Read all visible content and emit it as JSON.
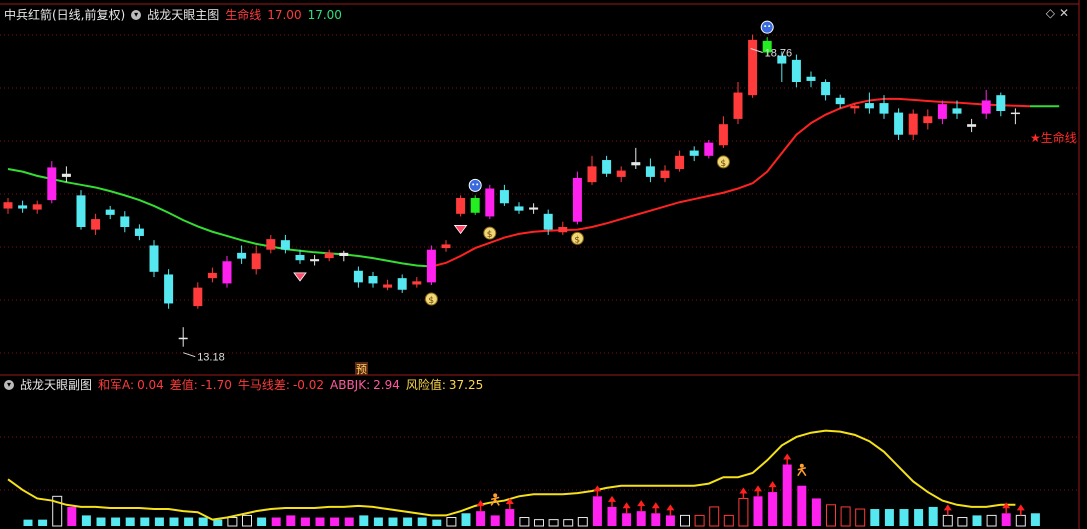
{
  "main_header": {
    "stock": "中兵红箭(日线,前复权)",
    "indicator": "战龙天眼主图",
    "life_line_label": "生命线",
    "life_line_val1": "17.00",
    "life_line_val2": "17.00"
  },
  "sub_header": {
    "indicator": "战龙天眼副图",
    "hejun_label": "和军A:",
    "hejun_val": "0.04",
    "chazhi_label": "差值:",
    "chazhi_val": "-1.70",
    "niuma_label": "牛马线差:",
    "niuma_val": "-0.02",
    "abbjk_label": "ABBJK:",
    "abbjk_val": "2.94",
    "risk_label": "风险值:",
    "risk_val": "37.25"
  },
  "annotations": {
    "high_label": "18.76",
    "low_label": "13.18",
    "life_line_tag": "★生命线",
    "pre_mark": "预"
  },
  "colors": {
    "up": "#ff3b3b",
    "down": "#55e8f0",
    "magenta": "#ff22ee",
    "green_line": "#33dd33",
    "red_line": "#ff2222",
    "yellow_line": "#f5e11a",
    "grid": "#7a1010"
  },
  "chart_data": [
    {
      "type": "candlestick",
      "title": "战龙天眼主图",
      "ylim": [
        12.7,
        19.3
      ],
      "candles": [
        {
          "o": 15.8,
          "c": 15.92,
          "h": 16.0,
          "l": 15.7,
          "style": "up"
        },
        {
          "o": 15.86,
          "c": 15.8,
          "h": 15.95,
          "l": 15.72,
          "style": "down"
        },
        {
          "o": 15.78,
          "c": 15.88,
          "h": 15.95,
          "l": 15.7,
          "style": "up"
        },
        {
          "o": 15.96,
          "c": 16.58,
          "h": 16.7,
          "l": 15.9,
          "style": "magenta"
        },
        {
          "o": 16.4,
          "c": 16.46,
          "h": 16.6,
          "l": 16.3,
          "style": "doji"
        },
        {
          "o": 16.05,
          "c": 15.45,
          "h": 16.15,
          "l": 15.4,
          "style": "down"
        },
        {
          "o": 15.4,
          "c": 15.6,
          "h": 15.7,
          "l": 15.3,
          "style": "up"
        },
        {
          "o": 15.78,
          "c": 15.68,
          "h": 15.85,
          "l": 15.6,
          "style": "down"
        },
        {
          "o": 15.65,
          "c": 15.45,
          "h": 15.75,
          "l": 15.35,
          "style": "down"
        },
        {
          "o": 15.42,
          "c": 15.28,
          "h": 15.5,
          "l": 15.2,
          "style": "down"
        },
        {
          "o": 15.1,
          "c": 14.6,
          "h": 15.2,
          "l": 14.5,
          "style": "down"
        },
        {
          "o": 14.55,
          "c": 14.0,
          "h": 14.65,
          "l": 13.9,
          "style": "down"
        },
        {
          "o": 13.35,
          "c": 13.35,
          "h": 13.55,
          "l": 13.18,
          "style": "doji"
        },
        {
          "o": 13.95,
          "c": 14.3,
          "h": 14.4,
          "l": 13.9,
          "style": "up"
        },
        {
          "o": 14.48,
          "c": 14.58,
          "h": 14.68,
          "l": 14.4,
          "style": "up"
        },
        {
          "o": 14.38,
          "c": 14.8,
          "h": 14.9,
          "l": 14.3,
          "style": "magenta"
        },
        {
          "o": 14.85,
          "c": 14.96,
          "h": 15.1,
          "l": 14.75,
          "style": "down"
        },
        {
          "o": 14.65,
          "c": 14.95,
          "h": 15.1,
          "l": 14.55,
          "style": "up"
        },
        {
          "o": 15.02,
          "c": 15.22,
          "h": 15.3,
          "l": 14.95,
          "style": "up"
        },
        {
          "o": 15.2,
          "c": 15.02,
          "h": 15.3,
          "l": 14.95,
          "style": "down"
        },
        {
          "o": 14.92,
          "c": 14.82,
          "h": 15.02,
          "l": 14.75,
          "style": "down"
        },
        {
          "o": 14.8,
          "c": 14.84,
          "h": 14.92,
          "l": 14.72,
          "style": "doji"
        },
        {
          "o": 14.86,
          "c": 14.96,
          "h": 15.02,
          "l": 14.8,
          "style": "up"
        },
        {
          "o": 14.96,
          "c": 14.9,
          "h": 15.0,
          "l": 14.8,
          "style": "doji"
        },
        {
          "o": 14.62,
          "c": 14.4,
          "h": 14.7,
          "l": 14.3,
          "style": "down"
        },
        {
          "o": 14.52,
          "c": 14.38,
          "h": 14.6,
          "l": 14.3,
          "style": "down"
        },
        {
          "o": 14.3,
          "c": 14.36,
          "h": 14.45,
          "l": 14.25,
          "style": "up"
        },
        {
          "o": 14.48,
          "c": 14.26,
          "h": 14.55,
          "l": 14.2,
          "style": "down"
        },
        {
          "o": 14.36,
          "c": 14.42,
          "h": 14.5,
          "l": 14.3,
          "style": "up"
        },
        {
          "o": 14.4,
          "c": 15.02,
          "h": 15.1,
          "l": 14.35,
          "style": "magenta"
        },
        {
          "o": 15.05,
          "c": 15.12,
          "h": 15.2,
          "l": 14.98,
          "style": "up"
        },
        {
          "o": 15.7,
          "c": 16.0,
          "h": 16.05,
          "l": 15.65,
          "style": "up"
        },
        {
          "o": 16.0,
          "c": 15.72,
          "h": 16.05,
          "l": 15.68,
          "style": "green"
        },
        {
          "o": 15.65,
          "c": 16.18,
          "h": 16.25,
          "l": 15.6,
          "style": "magenta"
        },
        {
          "o": 16.15,
          "c": 15.9,
          "h": 16.25,
          "l": 15.85,
          "style": "down"
        },
        {
          "o": 15.84,
          "c": 15.76,
          "h": 15.92,
          "l": 15.7,
          "style": "down"
        },
        {
          "o": 15.78,
          "c": 15.82,
          "h": 15.9,
          "l": 15.7,
          "style": "doji"
        },
        {
          "o": 15.7,
          "c": 15.4,
          "h": 15.78,
          "l": 15.3,
          "style": "down"
        },
        {
          "o": 15.35,
          "c": 15.45,
          "h": 15.55,
          "l": 15.3,
          "style": "up"
        },
        {
          "o": 15.55,
          "c": 16.38,
          "h": 16.5,
          "l": 15.5,
          "style": "magenta"
        },
        {
          "o": 16.3,
          "c": 16.6,
          "h": 16.8,
          "l": 16.25,
          "style": "up"
        },
        {
          "o": 16.72,
          "c": 16.46,
          "h": 16.8,
          "l": 16.4,
          "style": "down"
        },
        {
          "o": 16.4,
          "c": 16.52,
          "h": 16.6,
          "l": 16.3,
          "style": "up"
        },
        {
          "o": 16.68,
          "c": 16.62,
          "h": 16.95,
          "l": 16.55,
          "style": "doji"
        },
        {
          "o": 16.6,
          "c": 16.4,
          "h": 16.75,
          "l": 16.3,
          "style": "down"
        },
        {
          "o": 16.38,
          "c": 16.52,
          "h": 16.62,
          "l": 16.3,
          "style": "up"
        },
        {
          "o": 16.55,
          "c": 16.8,
          "h": 16.9,
          "l": 16.5,
          "style": "up"
        },
        {
          "o": 16.8,
          "c": 16.9,
          "h": 16.98,
          "l": 16.7,
          "style": "down"
        },
        {
          "o": 16.8,
          "c": 17.05,
          "h": 17.1,
          "l": 16.75,
          "style": "magenta"
        },
        {
          "o": 17.0,
          "c": 17.4,
          "h": 17.55,
          "l": 16.95,
          "style": "up"
        },
        {
          "o": 17.5,
          "c": 18.0,
          "h": 18.2,
          "l": 17.4,
          "style": "up"
        },
        {
          "o": 17.95,
          "c": 19.0,
          "h": 19.1,
          "l": 17.9,
          "style": "up"
        },
        {
          "o": 18.98,
          "c": 18.76,
          "h": 19.05,
          "l": 18.7,
          "style": "green"
        },
        {
          "o": 18.7,
          "c": 18.55,
          "h": 18.78,
          "l": 18.2,
          "style": "down"
        },
        {
          "o": 18.62,
          "c": 18.2,
          "h": 18.72,
          "l": 18.1,
          "style": "down"
        },
        {
          "o": 18.3,
          "c": 18.22,
          "h": 18.4,
          "l": 18.1,
          "style": "down"
        },
        {
          "o": 18.2,
          "c": 17.95,
          "h": 18.25,
          "l": 17.85,
          "style": "down"
        },
        {
          "o": 17.9,
          "c": 17.78,
          "h": 17.96,
          "l": 17.7,
          "style": "down"
        },
        {
          "o": 17.7,
          "c": 17.75,
          "h": 17.8,
          "l": 17.6,
          "style": "up"
        },
        {
          "o": 17.8,
          "c": 17.7,
          "h": 18.0,
          "l": 17.6,
          "style": "down"
        },
        {
          "o": 17.8,
          "c": 17.6,
          "h": 17.95,
          "l": 17.5,
          "style": "down"
        },
        {
          "o": 17.62,
          "c": 17.2,
          "h": 17.7,
          "l": 17.1,
          "style": "down"
        },
        {
          "o": 17.2,
          "c": 17.6,
          "h": 17.68,
          "l": 17.1,
          "style": "up"
        },
        {
          "o": 17.55,
          "c": 17.42,
          "h": 17.68,
          "l": 17.3,
          "style": "up"
        },
        {
          "o": 17.5,
          "c": 17.78,
          "h": 17.85,
          "l": 17.4,
          "style": "magenta"
        },
        {
          "o": 17.7,
          "c": 17.6,
          "h": 17.85,
          "l": 17.5,
          "style": "down"
        },
        {
          "o": 17.35,
          "c": 17.4,
          "h": 17.5,
          "l": 17.25,
          "style": "doji"
        },
        {
          "o": 17.6,
          "c": 17.85,
          "h": 18.05,
          "l": 17.5,
          "style": "magenta"
        },
        {
          "o": 17.95,
          "c": 17.65,
          "h": 18.0,
          "l": 17.55,
          "style": "down"
        },
        {
          "o": 17.6,
          "c": 17.62,
          "h": 17.7,
          "l": 17.4,
          "style": "doji"
        }
      ],
      "ma_green": [
        16.55,
        16.5,
        16.42,
        16.36,
        16.3,
        16.25,
        16.2,
        16.13,
        16.05,
        15.96,
        15.85,
        15.72,
        15.58,
        15.46,
        15.36,
        15.28,
        15.2,
        15.13,
        15.08,
        15.03,
        15.0,
        14.97,
        14.95,
        14.93,
        14.9,
        14.86,
        14.81,
        14.76,
        14.72,
        14.7
      ],
      "ma_red": [
        14.7,
        14.77,
        14.9,
        15.05,
        15.15,
        15.25,
        15.32,
        15.36,
        15.38,
        15.39,
        15.4,
        15.45,
        15.52,
        15.6,
        15.68,
        15.76,
        15.84,
        15.92,
        15.98,
        16.04,
        16.1,
        16.18,
        16.28,
        16.5,
        16.85,
        17.2,
        17.42,
        17.58,
        17.7,
        17.79,
        17.85,
        17.88,
        17.88,
        17.86,
        17.84,
        17.82,
        17.81,
        17.79,
        17.77,
        17.76,
        17.75,
        17.74
      ],
      "high_label_price": 18.76,
      "low_label_price": 13.18
    },
    {
      "type": "bar",
      "title": "战龙天眼副图",
      "ylim": [
        0,
        100
      ],
      "bars": [
        {
          "v": 6,
          "c": "cyan"
        },
        {
          "v": 6,
          "c": "cyan"
        },
        {
          "v": 28,
          "c": "hollow"
        },
        {
          "v": 18,
          "c": "magenta"
        },
        {
          "v": 10,
          "c": "cyan"
        },
        {
          "v": 8,
          "c": "cyan"
        },
        {
          "v": 8,
          "c": "cyan"
        },
        {
          "v": 8,
          "c": "cyan"
        },
        {
          "v": 8,
          "c": "cyan"
        },
        {
          "v": 8,
          "c": "cyan"
        },
        {
          "v": 8,
          "c": "cyan"
        },
        {
          "v": 8,
          "c": "cyan"
        },
        {
          "v": 8,
          "c": "cyan"
        },
        {
          "v": 6,
          "c": "cyan"
        },
        {
          "v": 8,
          "c": "hollow"
        },
        {
          "v": 10,
          "c": "hollow"
        },
        {
          "v": 8,
          "c": "cyan"
        },
        {
          "v": 8,
          "c": "magenta"
        },
        {
          "v": 10,
          "c": "magenta"
        },
        {
          "v": 8,
          "c": "magenta"
        },
        {
          "v": 8,
          "c": "magenta"
        },
        {
          "v": 8,
          "c": "magenta"
        },
        {
          "v": 8,
          "c": "magenta"
        },
        {
          "v": 10,
          "c": "cyan"
        },
        {
          "v": 8,
          "c": "cyan"
        },
        {
          "v": 8,
          "c": "cyan"
        },
        {
          "v": 8,
          "c": "cyan"
        },
        {
          "v": 8,
          "c": "cyan"
        },
        {
          "v": 6,
          "c": "cyan"
        },
        {
          "v": 8,
          "c": "hollow"
        },
        {
          "v": 12,
          "c": "cyan"
        },
        {
          "v": 14,
          "c": "magenta"
        },
        {
          "v": 10,
          "c": "magenta"
        },
        {
          "v": 16,
          "c": "magenta"
        },
        {
          "v": 8,
          "c": "hollow"
        },
        {
          "v": 6,
          "c": "hollow"
        },
        {
          "v": 6,
          "c": "hollow"
        },
        {
          "v": 6,
          "c": "hollow"
        },
        {
          "v": 8,
          "c": "hollow"
        },
        {
          "v": 28,
          "c": "magenta"
        },
        {
          "v": 18,
          "c": "magenta"
        },
        {
          "v": 12,
          "c": "magenta"
        },
        {
          "v": 14,
          "c": "magenta"
        },
        {
          "v": 12,
          "c": "magenta"
        },
        {
          "v": 10,
          "c": "magenta"
        },
        {
          "v": 10,
          "c": "hollow"
        },
        {
          "v": 10,
          "c": "hollow"
        },
        {
          "v": 18,
          "c": "hollow"
        },
        {
          "v": 10,
          "c": "hollow"
        },
        {
          "v": 26,
          "c": "hollow"
        },
        {
          "v": 28,
          "c": "magenta"
        },
        {
          "v": 32,
          "c": "magenta"
        },
        {
          "v": 58,
          "c": "magenta"
        },
        {
          "v": 38,
          "c": "magenta"
        },
        {
          "v": 26,
          "c": "magenta"
        },
        {
          "v": 20,
          "c": "hollow"
        },
        {
          "v": 18,
          "c": "hollow"
        },
        {
          "v": 16,
          "c": "hollow"
        },
        {
          "v": 16,
          "c": "cyan"
        },
        {
          "v": 16,
          "c": "cyan"
        },
        {
          "v": 16,
          "c": "cyan"
        },
        {
          "v": 16,
          "c": "cyan"
        },
        {
          "v": 18,
          "c": "cyan"
        },
        {
          "v": 10,
          "c": "hollow"
        },
        {
          "v": 8,
          "c": "hollow"
        },
        {
          "v": 10,
          "c": "cyan"
        },
        {
          "v": 10,
          "c": "hollow"
        },
        {
          "v": 12,
          "c": "magenta"
        },
        {
          "v": 10,
          "c": "hollow"
        },
        {
          "v": 12,
          "c": "cyan"
        }
      ],
      "yellow_line": [
        44,
        34,
        26,
        24,
        20,
        18,
        18,
        17,
        17,
        17,
        16,
        16,
        14,
        13,
        6,
        8,
        11,
        14,
        16,
        17,
        17,
        17,
        18,
        18,
        19,
        18,
        16,
        14,
        12,
        10,
        10,
        14,
        19,
        22,
        24,
        28,
        30,
        30,
        30,
        31,
        33,
        36,
        38,
        38,
        38,
        38,
        38,
        38,
        40,
        46,
        46,
        50,
        62,
        76,
        84,
        88,
        90,
        89,
        86,
        80,
        70,
        56,
        42,
        32,
        24,
        20,
        18,
        18,
        20,
        20
      ],
      "marker_indices": [
        31,
        33,
        39,
        40,
        41,
        42,
        43,
        44,
        49,
        50,
        51,
        52,
        63,
        67,
        68
      ],
      "figure_indices": [
        32,
        53
      ]
    }
  ]
}
